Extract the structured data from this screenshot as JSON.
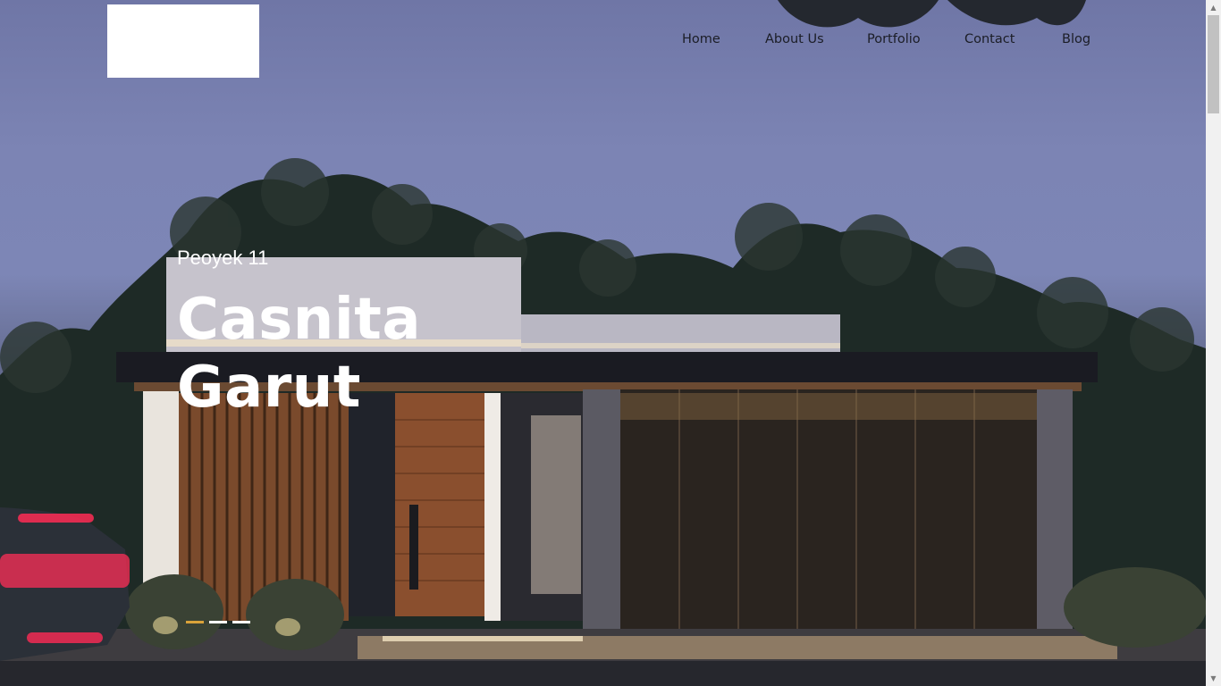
{
  "nav": {
    "items": [
      {
        "label": "Home"
      },
      {
        "label": "About Us"
      },
      {
        "label": "Portfolio"
      },
      {
        "label": "Contact"
      },
      {
        "label": "Blog"
      }
    ]
  },
  "hero": {
    "project_label": "Peoyek 11",
    "title": "Casnita Garut",
    "slides": {
      "count": 3,
      "active_index": 0
    },
    "accent_color": "#d9a23a"
  },
  "icons": {
    "scroll_up": "triangle-up",
    "scroll_down": "triangle-down"
  }
}
